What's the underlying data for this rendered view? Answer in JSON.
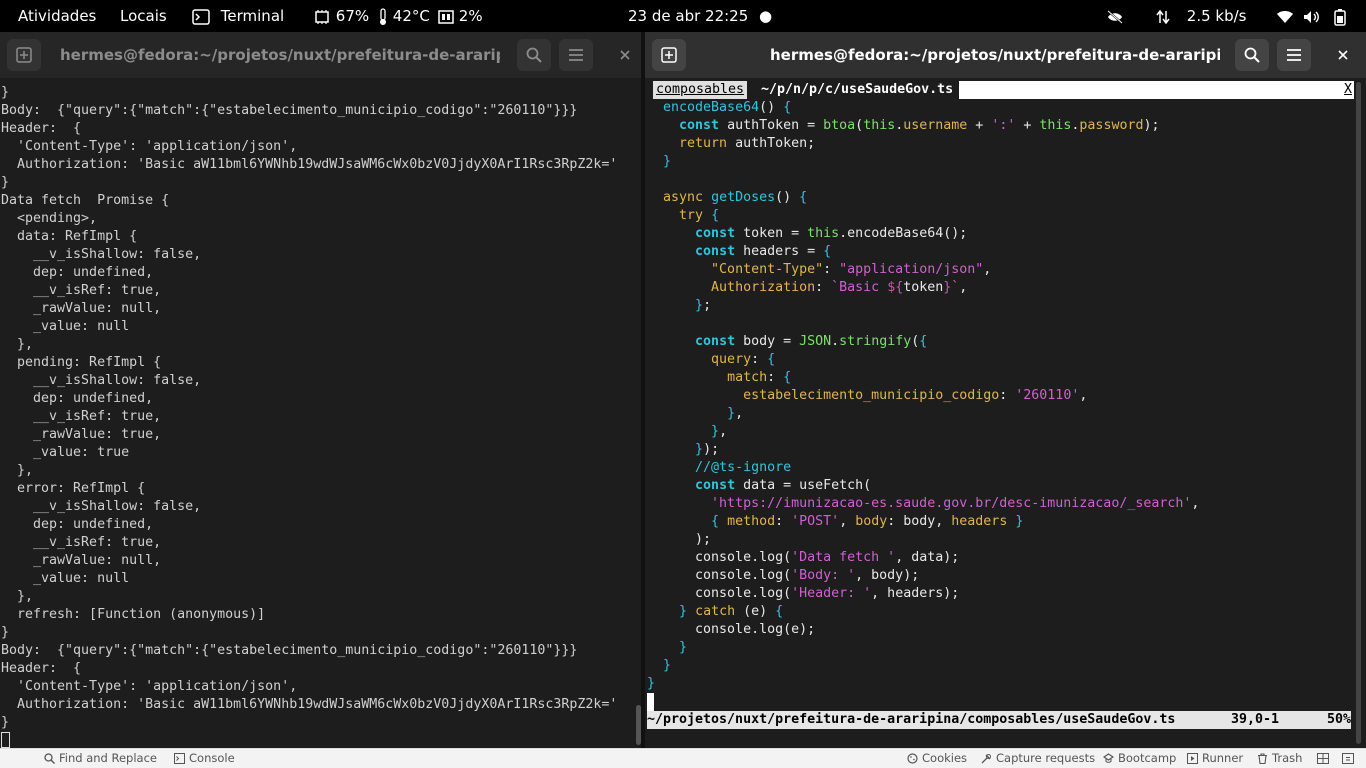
{
  "topbar": {
    "activities": "Atividades",
    "places": "Locais",
    "app": "Terminal",
    "cpu": "67%",
    "temp": "42°C",
    "mem": "2%",
    "datetime": "23 de abr  22:25",
    "net_speed": "2.5 kb/s"
  },
  "left_window": {
    "title": "hermes@fedora:~/projetos/nuxt/prefeitura-de-araripina — n...",
    "lines": [
      "}",
      "Body:  {\"query\":{\"match\":{\"estabelecimento_municipio_codigo\":\"260110\"}}}",
      "Header:  {",
      "  'Content-Type': 'application/json',",
      "  Authorization: 'Basic aW11bml6YWNhb19wdWJsaWM6cWx0bzV0JjdyX0ArI1Rsc3RpZ2k='",
      "}",
      "Data fetch  Promise {",
      "  <pending>,",
      "  data: RefImpl {",
      "    __v_isShallow: false,",
      "    dep: undefined,",
      "    __v_isRef: true,",
      "    _rawValue: null,",
      "    _value: null",
      "  },",
      "  pending: RefImpl {",
      "    __v_isShallow: false,",
      "    dep: undefined,",
      "    __v_isRef: true,",
      "    _rawValue: true,",
      "    _value: true",
      "  },",
      "  error: RefImpl {",
      "    __v_isShallow: false,",
      "    dep: undefined,",
      "    __v_isRef: true,",
      "    _rawValue: null,",
      "    _value: null",
      "  },",
      "  refresh: [Function (anonymous)]",
      "}",
      "Body:  {\"query\":{\"match\":{\"estabelecimento_municipio_codigo\":\"260110\"}}}",
      "Header:  {",
      "  'Content-Type': 'application/json',",
      "  Authorization: 'Basic aW11bml6YWNhb19wdWJsaWM6cWx0bzV0JjdyX0ArI1Rsc3RpZ2k='",
      "}"
    ]
  },
  "right_window": {
    "title": "hermes@fedora:~/projetos/nuxt/prefeitura-de-araripina — nvim .",
    "tab1": "composables",
    "tab2": "~/p/n/p/c/useSaudeGov.ts",
    "tab_close": "X",
    "status_path": "~/projetos/nuxt/prefeitura-de-araripina/composables/useSaudeGov.ts",
    "status_pos": "39,0-1",
    "status_pct": "50%",
    "code_lines": [
      [
        [
          "  ",
          "tx"
        ],
        [
          "encodeBase64",
          "fn"
        ],
        [
          "() ",
          "tx"
        ],
        [
          "{",
          "br"
        ]
      ],
      [
        [
          "    ",
          "tx"
        ],
        [
          "const",
          "ty"
        ],
        [
          " authToken = ",
          "tx"
        ],
        [
          "btoa",
          "cl"
        ],
        [
          "(",
          "tx"
        ],
        [
          "this",
          "cl"
        ],
        [
          ".",
          "tx"
        ],
        [
          "username",
          "pr"
        ],
        [
          " + ",
          "tx"
        ],
        [
          "':'",
          "st"
        ],
        [
          " + ",
          "tx"
        ],
        [
          "this",
          "cl"
        ],
        [
          ".",
          "tx"
        ],
        [
          "password",
          "pr"
        ],
        [
          ");",
          "tx"
        ]
      ],
      [
        [
          "    ",
          "tx"
        ],
        [
          "return",
          "kw"
        ],
        [
          " authToken;",
          "tx"
        ]
      ],
      [
        [
          "  ",
          "tx"
        ],
        [
          "}",
          "br"
        ]
      ],
      [
        [
          "",
          "tx"
        ]
      ],
      [
        [
          "  ",
          "tx"
        ],
        [
          "async",
          "kw"
        ],
        [
          " ",
          "tx"
        ],
        [
          "getDoses",
          "fn"
        ],
        [
          "() ",
          "tx"
        ],
        [
          "{",
          "br"
        ]
      ],
      [
        [
          "    ",
          "tx"
        ],
        [
          "try",
          "kw"
        ],
        [
          " ",
          "tx"
        ],
        [
          "{",
          "br"
        ]
      ],
      [
        [
          "      ",
          "tx"
        ],
        [
          "const",
          "ty"
        ],
        [
          " token = ",
          "tx"
        ],
        [
          "this",
          "cl"
        ],
        [
          ".encodeBase64();",
          "tx"
        ]
      ],
      [
        [
          "      ",
          "tx"
        ],
        [
          "const",
          "ty"
        ],
        [
          " headers = ",
          "tx"
        ],
        [
          "{",
          "br"
        ]
      ],
      [
        [
          "        ",
          "tx"
        ],
        [
          "\"Content-Type\"",
          "pr"
        ],
        [
          ": ",
          "tx"
        ],
        [
          "\"application/json\"",
          "st"
        ],
        [
          ",",
          "tx"
        ]
      ],
      [
        [
          "        ",
          "tx"
        ],
        [
          "Authorization",
          "pr"
        ],
        [
          ": ",
          "tx"
        ],
        [
          "`Basic ",
          "st"
        ],
        [
          "${",
          "vc"
        ],
        [
          "token",
          "tx"
        ],
        [
          "}",
          "vc"
        ],
        [
          "`",
          "st"
        ],
        [
          ",",
          "tx"
        ]
      ],
      [
        [
          "      ",
          "tx"
        ],
        [
          "}",
          "br"
        ],
        [
          ";",
          "tx"
        ]
      ],
      [
        [
          "",
          "tx"
        ]
      ],
      [
        [
          "      ",
          "tx"
        ],
        [
          "const",
          "ty"
        ],
        [
          " body = ",
          "tx"
        ],
        [
          "JSON",
          "cl"
        ],
        [
          ".",
          "tx"
        ],
        [
          "stringify",
          "cl"
        ],
        [
          "(",
          "tx"
        ],
        [
          "{",
          "br"
        ]
      ],
      [
        [
          "        ",
          "tx"
        ],
        [
          "query",
          "pr"
        ],
        [
          ": ",
          "tx"
        ],
        [
          "{",
          "br"
        ]
      ],
      [
        [
          "          ",
          "tx"
        ],
        [
          "match",
          "pr"
        ],
        [
          ": ",
          "tx"
        ],
        [
          "{",
          "br"
        ]
      ],
      [
        [
          "            ",
          "tx"
        ],
        [
          "estabelecimento_municipio_codigo",
          "pr"
        ],
        [
          ": ",
          "tx"
        ],
        [
          "'260110'",
          "st"
        ],
        [
          ",",
          "tx"
        ]
      ],
      [
        [
          "          ",
          "tx"
        ],
        [
          "}",
          "br"
        ],
        [
          ",",
          "tx"
        ]
      ],
      [
        [
          "        ",
          "tx"
        ],
        [
          "}",
          "br"
        ],
        [
          ",",
          "tx"
        ]
      ],
      [
        [
          "      ",
          "tx"
        ],
        [
          "}",
          "br"
        ],
        [
          ");",
          "tx"
        ]
      ],
      [
        [
          "      ",
          "tx"
        ],
        [
          "//@ts-ignore",
          "fn"
        ]
      ],
      [
        [
          "      ",
          "tx"
        ],
        [
          "const",
          "ty"
        ],
        [
          " data = useFetch(",
          "tx"
        ]
      ],
      [
        [
          "        ",
          "tx"
        ],
        [
          "'https://imunizacao-es.saude.gov.br/desc-imunizacao/_search'",
          "st"
        ],
        [
          ",",
          "tx"
        ]
      ],
      [
        [
          "        ",
          "tx"
        ],
        [
          "{",
          "br"
        ],
        [
          " ",
          "tx"
        ],
        [
          "method",
          "pr"
        ],
        [
          ": ",
          "tx"
        ],
        [
          "'POST'",
          "st"
        ],
        [
          ", ",
          "tx"
        ],
        [
          "body",
          "pr"
        ],
        [
          ": body, ",
          "tx"
        ],
        [
          "headers",
          "pr"
        ],
        [
          " ",
          "tx"
        ],
        [
          "}",
          "br"
        ]
      ],
      [
        [
          "      );",
          "tx"
        ]
      ],
      [
        [
          "      console.log(",
          "tx"
        ],
        [
          "'Data fetch '",
          "st"
        ],
        [
          ", data);",
          "tx"
        ]
      ],
      [
        [
          "      console.log(",
          "tx"
        ],
        [
          "'Body: '",
          "st"
        ],
        [
          ", body);",
          "tx"
        ]
      ],
      [
        [
          "      console.log(",
          "tx"
        ],
        [
          "'Header: '",
          "st"
        ],
        [
          ", headers);",
          "tx"
        ]
      ],
      [
        [
          "    ",
          "tx"
        ],
        [
          "}",
          "br"
        ],
        [
          " ",
          "tx"
        ],
        [
          "catch",
          "kw"
        ],
        [
          " (e) ",
          "tx"
        ],
        [
          "{",
          "br"
        ]
      ],
      [
        [
          "      console.log(e);",
          "tx"
        ]
      ],
      [
        [
          "    ",
          "tx"
        ],
        [
          "}",
          "br"
        ]
      ],
      [
        [
          "  ",
          "tx"
        ],
        [
          "}",
          "br"
        ]
      ],
      [
        [
          "}",
          "br"
        ]
      ]
    ]
  },
  "bottombar": {
    "find_replace": "Find and Replace",
    "console": "Console",
    "cookies": "Cookies",
    "capture": "Capture requests",
    "bootcamp": "Bootcamp",
    "runner": "Runner",
    "trash": "Trash"
  },
  "colors": {
    "keyword": "#e0b64a",
    "type": "#2ec6dc",
    "string": "#d060d0",
    "class": "#7ce06c"
  }
}
